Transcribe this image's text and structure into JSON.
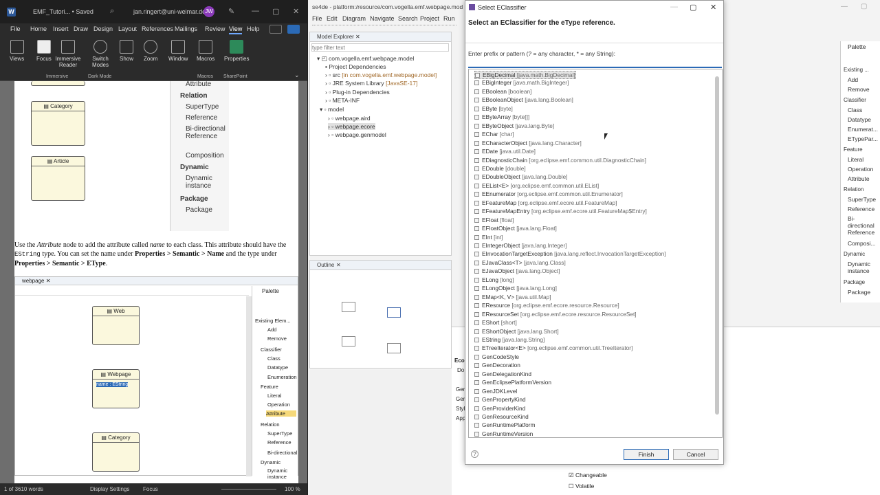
{
  "word": {
    "logo": "W",
    "doc_title": "EMF_Tutori... • Saved",
    "user_email": "jan.ringert@uni-weimar.de",
    "avatar": "JW",
    "menu": [
      "File",
      "Home",
      "Insert",
      "Draw",
      "Design",
      "Layout",
      "References",
      "Mailings",
      "Review",
      "View",
      "Help"
    ],
    "active_menu": "View",
    "ribbon": {
      "views": "Views",
      "focus": "Focus",
      "immersive_reader": "Immersive Reader",
      "switch_modes": "Switch Modes",
      "show": "Show",
      "zoom": "Zoom",
      "window": "Window",
      "macros": "Macros",
      "properties": "Properties",
      "group_immersive": "Immersive",
      "group_dark": "Dark Mode",
      "group_macros": "Macros",
      "group_sharepoint": "SharePoint"
    },
    "page": {
      "top_boxes": [
        "Category",
        "Article"
      ],
      "palette_top": {
        "attribute": "Attribute",
        "relation": "Relation",
        "supertype": "SuperType",
        "reference": "Reference",
        "bidirectional": "Bi-directional Reference",
        "composition": "Composition",
        "dynamic": "Dynamic",
        "dynamic_instance": "Dynamic instance",
        "package_grp": "Package",
        "package": "Package"
      },
      "para": {
        "p1": "Use the ",
        "attr_node": "Attribute",
        "p2": " node to add the attribute called ",
        "name_word": "name",
        "p3": " to each class. This attribute should have the ",
        "type_code": "EString",
        "p4": " type. You can set the name under ",
        "path1": "Properties > Semantic > Name",
        "p5": " and the type under ",
        "path2": "Properties > Semantic > EType",
        "p6": "."
      },
      "embed": {
        "tab": "webpage",
        "boxes": [
          "Web",
          "Webpage",
          "Category"
        ],
        "selected_attr": "name : EString",
        "palette_title": "Palette",
        "existing": "Existing Elem...",
        "add": "Add",
        "remove": "Remove",
        "classifier": "Classifier",
        "class": "Class",
        "datatype": "Datatype",
        "enumeration": "Enumeration",
        "feature": "Feature",
        "literal": "Literal",
        "operation": "Operation",
        "attribute": "Attribute",
        "relation": "Relation",
        "supertype": "SuperType",
        "reference": "Reference",
        "bidirectional": "Bi-directional",
        "dynamic": "Dynamic",
        "dynamic_instance": "Dynamic instance"
      }
    },
    "status": {
      "page": "1 of 3610 words",
      "display": "Display Settings",
      "focus": "Focus",
      "zoom": "100 %"
    }
  },
  "eclipse": {
    "title": "se4de - platform:/resource/com.vogella.emf.webpage.mod",
    "menu": [
      "File",
      "Edit",
      "Diagram",
      "Navigate",
      "Search",
      "Project",
      "Run"
    ],
    "model_explorer": {
      "tab": "Model Explorer",
      "filter_placeholder": "type filter text",
      "tree": [
        {
          "label": "com.vogella.emf.webpage.model",
          "deco": ""
        },
        {
          "label": "Project Dependencies",
          "deco": ""
        },
        {
          "label": "src",
          "deco": "[in com.vogella.emf.webpage.model]"
        },
        {
          "label": "JRE System Library",
          "deco": "[JavaSE-17]"
        },
        {
          "label": "Plug-in Dependencies",
          "deco": ""
        },
        {
          "label": "META-INF",
          "deco": ""
        },
        {
          "label": "model",
          "deco": ""
        },
        {
          "label": "webpage.aird",
          "deco": ""
        },
        {
          "label": "webpage.ecore",
          "deco": ""
        },
        {
          "label": "webpage.genmodel",
          "deco": ""
        }
      ]
    },
    "outline_tab": "Outline",
    "right_palette": {
      "title": "Palette",
      "existing": "Existing ...",
      "add": "Add",
      "remove": "Remove",
      "classifier": "Classifier",
      "class": "Class",
      "datatype": "Datatype",
      "enumerat": "Enumerat...",
      "etypepar": "ETypePar...",
      "feature": "Feature",
      "literal": "Literal",
      "operation": "Operation",
      "attribute": "Attribute",
      "relation": "Relation",
      "supertype": "SuperType",
      "reference": "Reference",
      "bidirectional": "Bi-directional Reference",
      "composi": "Composi...",
      "dynamic": "Dynamic",
      "dynamic_instance": "Dynamic instance",
      "package_grp": "Package",
      "package": "Package"
    },
    "props": {
      "changeable": "Changeable",
      "volatile": "Volatile",
      "side_labels": [
        "Eco",
        "Do",
        "Gen",
        "Gen",
        "Styl",
        "App"
      ]
    }
  },
  "dialog": {
    "title": "Select EClassifier",
    "message": "Select an EClassifier for the eType reference.",
    "prompt": "Enter prefix or pattern (? = any character, * = any String):",
    "input_value": "",
    "items": [
      {
        "name": "EBigDecimal",
        "pkg": "[java.math.BigDecimal]"
      },
      {
        "name": "EBigInteger",
        "pkg": "[java.math.BigInteger]"
      },
      {
        "name": "EBoolean",
        "pkg": "[boolean]"
      },
      {
        "name": "EBooleanObject",
        "pkg": "[java.lang.Boolean]"
      },
      {
        "name": "EByte",
        "pkg": "[byte]"
      },
      {
        "name": "EByteArray",
        "pkg": "[byte[]]"
      },
      {
        "name": "EByteObject",
        "pkg": "[java.lang.Byte]"
      },
      {
        "name": "EChar",
        "pkg": "[char]"
      },
      {
        "name": "ECharacterObject",
        "pkg": "[java.lang.Character]"
      },
      {
        "name": "EDate",
        "pkg": "[java.util.Date]"
      },
      {
        "name": "EDiagnosticChain",
        "pkg": "[org.eclipse.emf.common.util.DiagnosticChain]"
      },
      {
        "name": "EDouble",
        "pkg": "[double]"
      },
      {
        "name": "EDoubleObject",
        "pkg": "[java.lang.Double]"
      },
      {
        "name": "EEList<E>",
        "pkg": "[org.eclipse.emf.common.util.EList]"
      },
      {
        "name": "EEnumerator",
        "pkg": "[org.eclipse.emf.common.util.Enumerator]"
      },
      {
        "name": "EFeatureMap",
        "pkg": "[org.eclipse.emf.ecore.util.FeatureMap]"
      },
      {
        "name": "EFeatureMapEntry",
        "pkg": "[org.eclipse.emf.ecore.util.FeatureMap$Entry]"
      },
      {
        "name": "EFloat",
        "pkg": "[float]"
      },
      {
        "name": "EFloatObject",
        "pkg": "[java.lang.Float]"
      },
      {
        "name": "EInt",
        "pkg": "[int]"
      },
      {
        "name": "EIntegerObject",
        "pkg": "[java.lang.Integer]"
      },
      {
        "name": "EInvocationTargetException",
        "pkg": "[java.lang.reflect.InvocationTargetException]"
      },
      {
        "name": "EJavaClass<T>",
        "pkg": "[java.lang.Class]"
      },
      {
        "name": "EJavaObject",
        "pkg": "[java.lang.Object]"
      },
      {
        "name": "ELong",
        "pkg": "[long]"
      },
      {
        "name": "ELongObject",
        "pkg": "[java.lang.Long]"
      },
      {
        "name": "EMap<K, V>",
        "pkg": "[java.util.Map]"
      },
      {
        "name": "EResource",
        "pkg": "[org.eclipse.emf.ecore.resource.Resource]"
      },
      {
        "name": "EResourceSet",
        "pkg": "[org.eclipse.emf.ecore.resource.ResourceSet]"
      },
      {
        "name": "EShort",
        "pkg": "[short]"
      },
      {
        "name": "EShortObject",
        "pkg": "[java.lang.Short]"
      },
      {
        "name": "EString",
        "pkg": "[java.lang.String]"
      },
      {
        "name": "ETreeIterator<E>",
        "pkg": "[org.eclipse.emf.common.util.TreeIterator]"
      },
      {
        "name": "GenCodeStyle",
        "pkg": ""
      },
      {
        "name": "GenDecoration",
        "pkg": ""
      },
      {
        "name": "GenDelegationKind",
        "pkg": ""
      },
      {
        "name": "GenEclipsePlatformVersion",
        "pkg": ""
      },
      {
        "name": "GenJDKLevel",
        "pkg": ""
      },
      {
        "name": "GenPropertyKind",
        "pkg": ""
      },
      {
        "name": "GenProviderKind",
        "pkg": ""
      },
      {
        "name": "GenResourceKind",
        "pkg": ""
      },
      {
        "name": "GenRuntimePlatform",
        "pkg": ""
      },
      {
        "name": "GenRuntimeVersion",
        "pkg": ""
      }
    ],
    "help": "?",
    "finish": "Finish",
    "cancel": "Cancel"
  }
}
